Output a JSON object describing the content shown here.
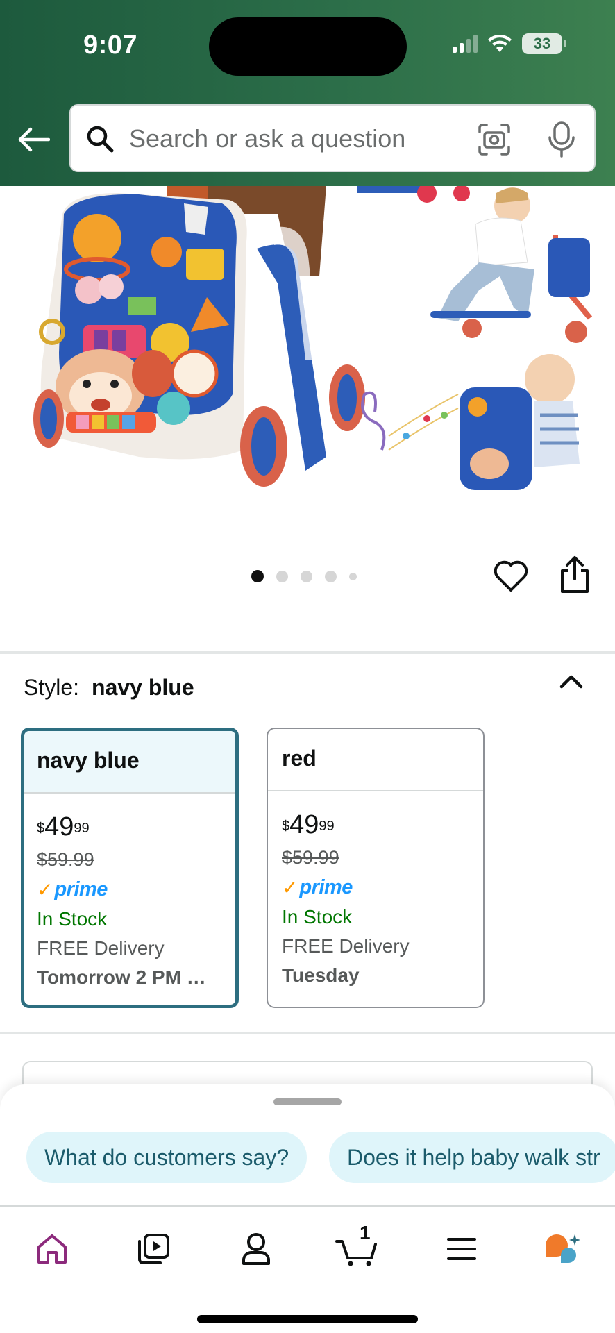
{
  "status_bar": {
    "time": "9:07",
    "battery": "33"
  },
  "search": {
    "placeholder": "Search or ask a question"
  },
  "gallery": {
    "dot_count": 5,
    "active_index": 0
  },
  "style_selector": {
    "label": "Style:",
    "selected_value": "navy blue",
    "options": [
      {
        "name": "navy blue",
        "price_symbol": "$",
        "price_whole": "49",
        "price_fraction": "99",
        "list_price": "$59.99",
        "prime": "prime",
        "stock": "In Stock",
        "delivery": "FREE Delivery",
        "delivery_date": "Tomorrow 2 PM …"
      },
      {
        "name": "red",
        "price_symbol": "$",
        "price_whole": "49",
        "price_fraction": "99",
        "list_price": "$59.99",
        "prime": "prime",
        "stock": "In Stock",
        "delivery": "FREE Delivery",
        "delivery_date": "Tuesday"
      }
    ]
  },
  "rufus": {
    "chips": [
      "What do customers say?",
      "Does it help baby walk str"
    ]
  },
  "tabbar": {
    "cart_count": "1",
    "items": [
      "home-icon",
      "video-icon",
      "account-icon",
      "cart-icon",
      "menu-icon",
      "rufus-icon"
    ]
  },
  "colors": {
    "header_green": "#2c6e49",
    "selected_border": "#2d6e80",
    "in_stock": "#007600",
    "prime_blue": "#1a98ff",
    "chip_bg": "#dff5fa"
  }
}
